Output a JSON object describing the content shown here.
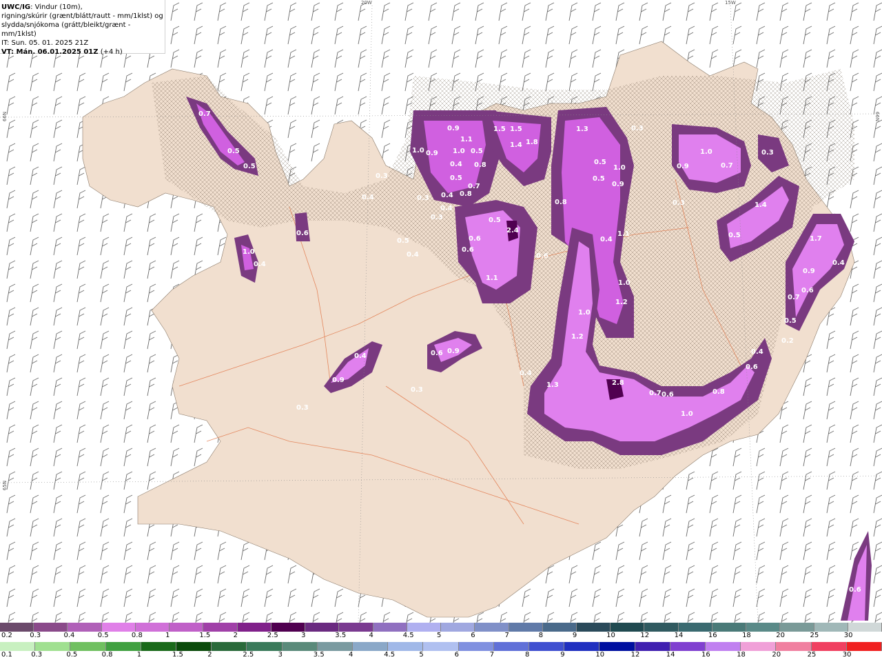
{
  "header": {
    "model": "UWC/IG",
    "line1_rest": ": Vindur (10m),",
    "line2": "rigning/skúrir (grænt/blátt/rautt - mm/1klst) og",
    "line3": "slydda/snjókoma (grátt/bleikt/grænt - mm/1klst)",
    "issue_time": "IT: Sun. 05. 01. 2025 21Z",
    "valid_time_label": "VT: Mán. 06.01.2025 01Z",
    "valid_offset": "(+4 h)"
  },
  "grid_labels": {
    "top_left_lon": "20W",
    "top_right_lon": "15W",
    "left_lat_upper": "66N",
    "left_lat_lower": "65N",
    "right_lat_upper": "66N",
    "right_lat_lower": "64N"
  },
  "precip_labels": [
    "0.7",
    "0.5",
    "0.5",
    "1.0",
    "0.4",
    "0.6",
    "0.4",
    "0.3",
    "0.5",
    "0.3",
    "0.4",
    "0.4",
    "0.3",
    "0.5",
    "0.4",
    "0.9",
    "1.0",
    "0.9",
    "1.0",
    "1.1",
    "0.5",
    "0.4",
    "0.8",
    "0.8",
    "0.7",
    "0.6",
    "0.6",
    "0.9",
    "0.3",
    "1.5",
    "1.5",
    "1.4",
    "1.8",
    "2.4",
    "0.5",
    "1.1",
    "0.8",
    "0.6",
    "1.3",
    "0.5",
    "1.0",
    "0.5",
    "0.9",
    "0.4",
    "1.1",
    "1.0",
    "1.2",
    "1.0",
    "1.2",
    "1.3",
    "0.4",
    "2.8",
    "0.7",
    "0.6",
    "1.0",
    "0.8",
    "0.6",
    "0.4",
    "0.3",
    "0.9",
    "1.0",
    "0.7",
    "0.3",
    "0.3",
    "1.4",
    "0.5",
    "1.7",
    "0.4",
    "0.9",
    "0.6",
    "0.7",
    "0.5",
    "0.2",
    "0.6",
    "0.4",
    "0.9",
    "0.6",
    "0.3"
  ],
  "colorbar_snow": {
    "labels": [
      "0.2",
      "0.3",
      "0.4",
      "0.5",
      "0.8",
      "1",
      "1.5",
      "2",
      "2.5",
      "3",
      "3.5",
      "4",
      "4.5",
      "5",
      "6",
      "7",
      "8",
      "9",
      "10",
      "12",
      "14",
      "16",
      "18",
      "20",
      "25",
      "30"
    ],
    "colors": [
      "#6b4a6b",
      "#8a4a8a",
      "#b060b8",
      "#e080e8",
      "#d070d8",
      "#c060c8",
      "#a040a8",
      "#80208a",
      "#500050",
      "#6a2a80",
      "#7a3a90",
      "#9070c0",
      "#b0b0f0",
      "#a0a8e0",
      "#8090c8",
      "#607aa8",
      "#4a6a8a",
      "#2a4a5a",
      "#204a50",
      "#305a60",
      "#3a6a70",
      "#4a7a78",
      "#5a8a88",
      "#7a9a98",
      "#a0b8b8",
      "#d0d8d8"
    ]
  },
  "colorbar_rain": {
    "labels": [
      "0.1",
      "0.3",
      "0.5",
      "0.8",
      "1",
      "1.5",
      "2",
      "2.5",
      "3",
      "3.5",
      "4",
      "4.5",
      "5",
      "6",
      "7",
      "8",
      "9",
      "10",
      "12",
      "14",
      "16",
      "18",
      "20",
      "25",
      "30"
    ],
    "colors": [
      "#c8f0c0",
      "#a0e090",
      "#70c060",
      "#40a040",
      "#1a6a1a",
      "#0a4a0a",
      "#2a6a3a",
      "#3a7a5a",
      "#5a8a7a",
      "#7a9aa0",
      "#8aa8c8",
      "#a0b8e8",
      "#b0c0f0",
      "#8090e0",
      "#6070d8",
      "#4050d0",
      "#2030c0",
      "#0010a0",
      "#4020b0",
      "#8040d0",
      "#c080f0",
      "#f0a0d8",
      "#f080a0",
      "#f04060",
      "#f02020"
    ]
  }
}
